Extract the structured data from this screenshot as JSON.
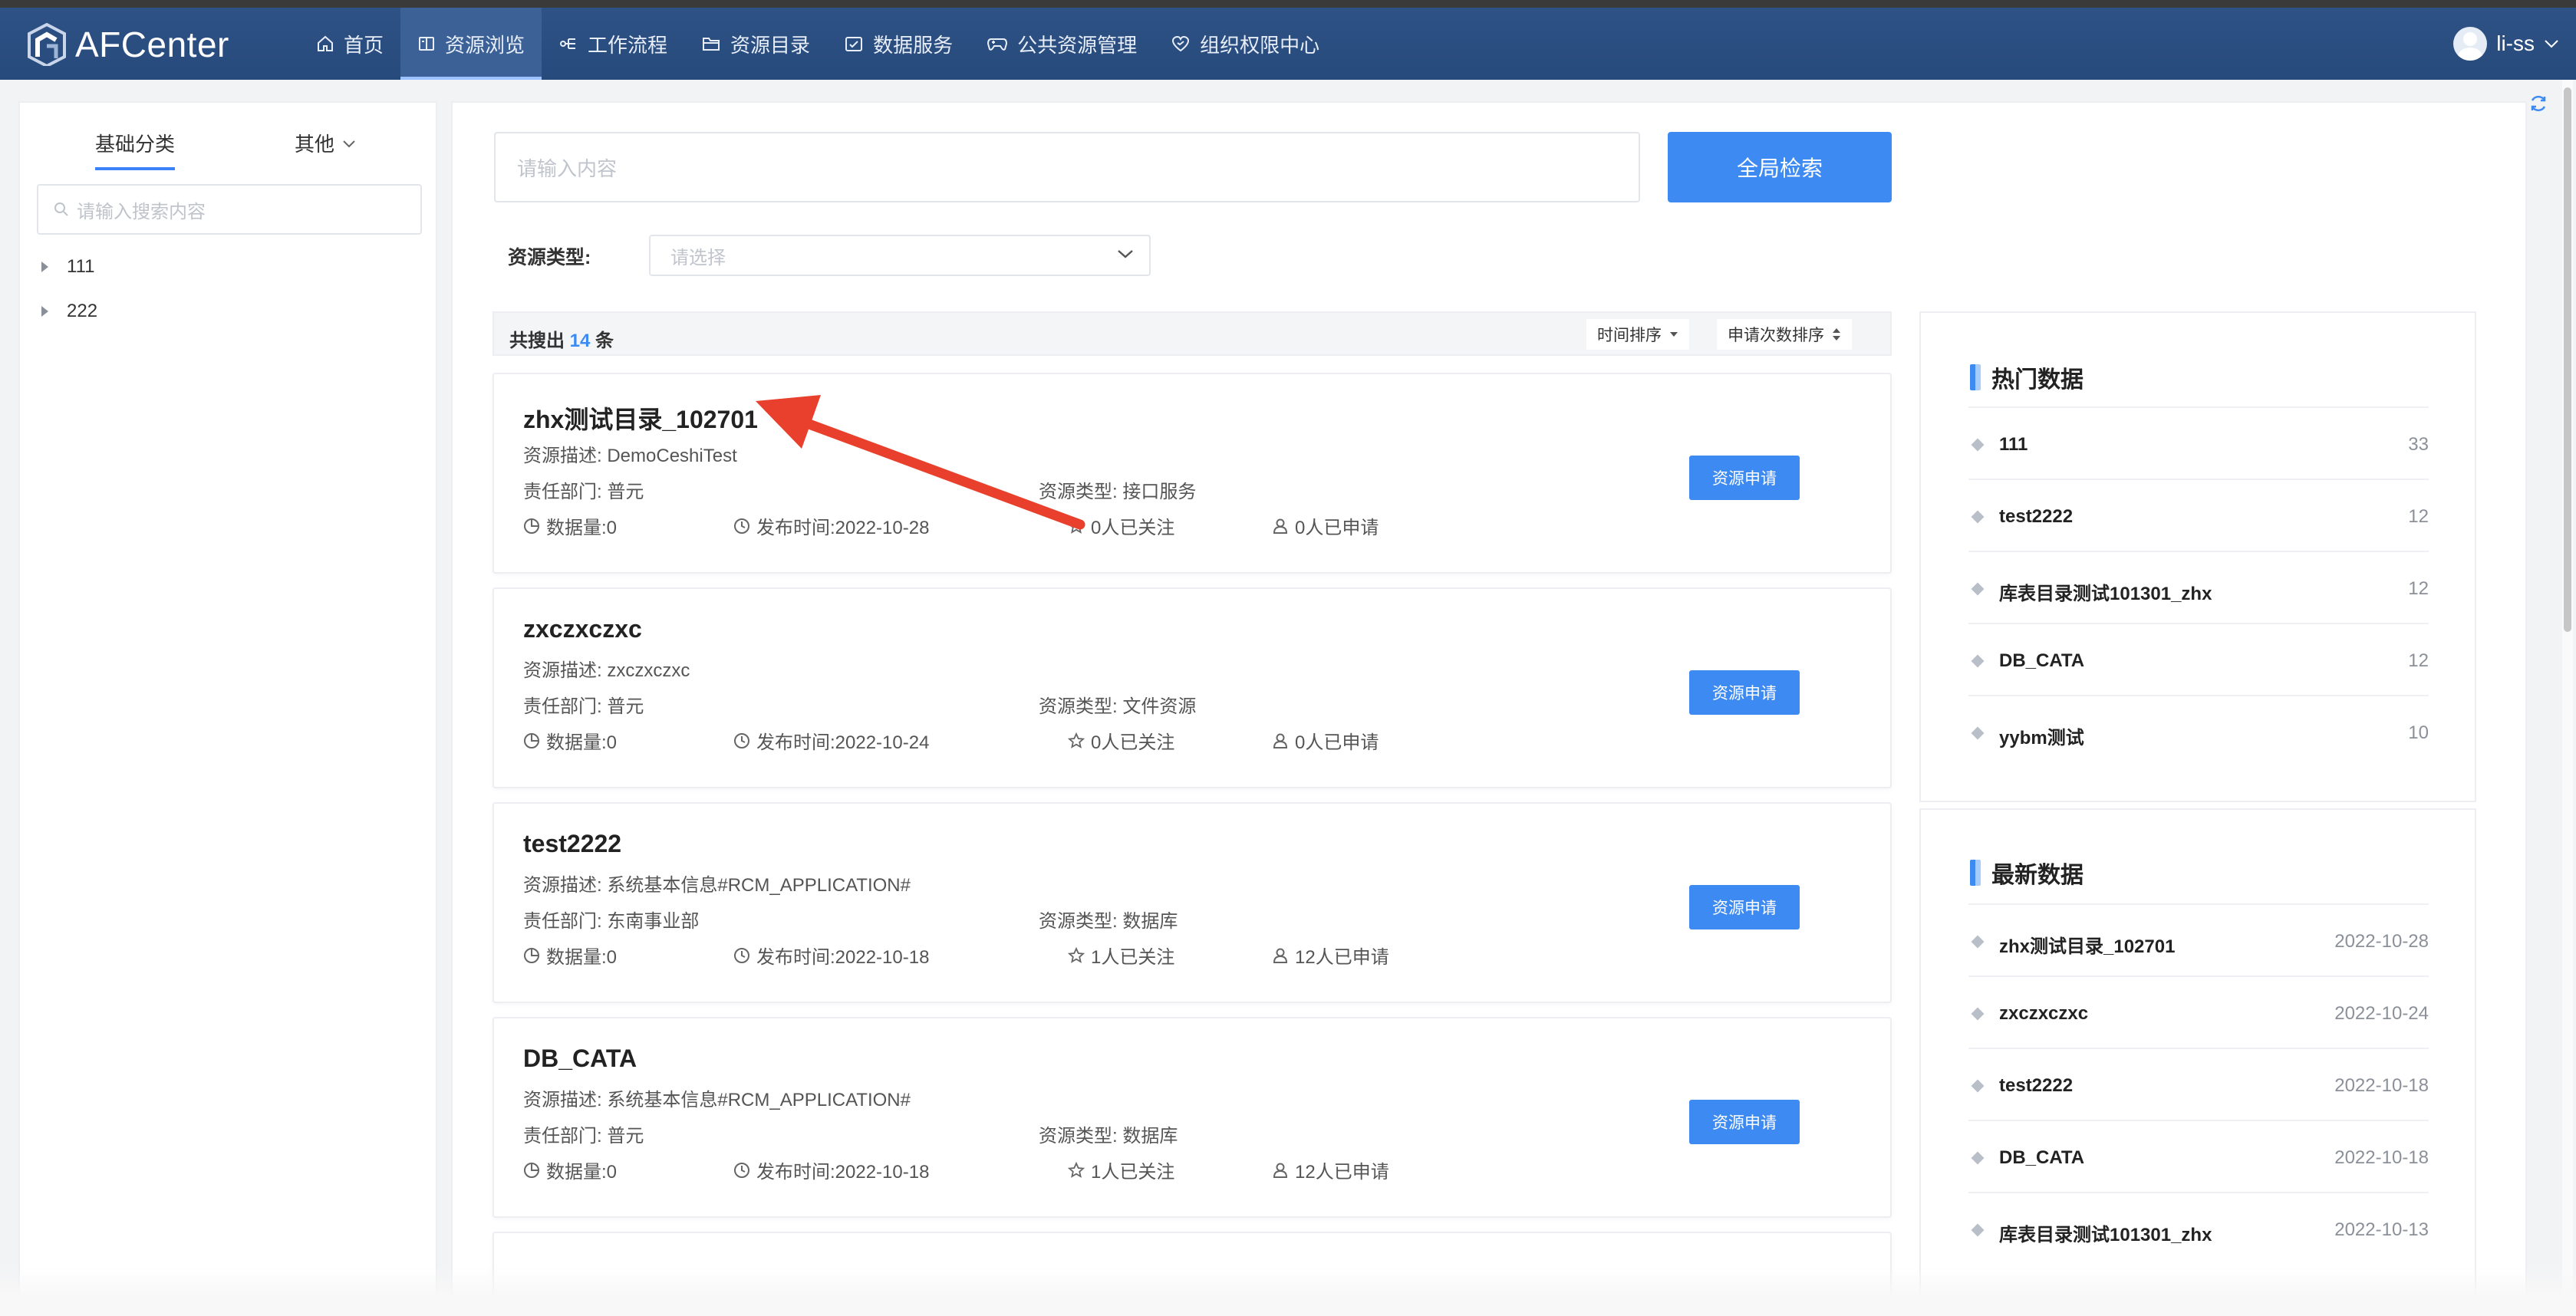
{
  "app": {
    "title": "AFCenter"
  },
  "nav": {
    "items": [
      {
        "label": "首页",
        "icon": "home-icon"
      },
      {
        "label": "资源浏览",
        "icon": "book-icon"
      },
      {
        "label": "工作流程",
        "icon": "flow-icon"
      },
      {
        "label": "资源目录",
        "icon": "folder-icon"
      },
      {
        "label": "数据服务",
        "icon": "calendar-check-icon"
      },
      {
        "label": "公共资源管理",
        "icon": "gamepad-icon"
      },
      {
        "label": "组织权限中心",
        "icon": "heart-shield-icon"
      }
    ],
    "active_index": 1,
    "user": "li-ss"
  },
  "sidebar": {
    "tabs": [
      "基础分类",
      "其他"
    ],
    "search_placeholder": "请输入搜索内容",
    "tree": [
      "111",
      "222"
    ]
  },
  "search": {
    "placeholder": "请输入内容",
    "button": "全局检索",
    "type_label": "资源类型:",
    "type_placeholder": "请选择"
  },
  "results": {
    "prefix": "共搜出",
    "count": "14",
    "suffix": "条",
    "sort_time": "时间排序",
    "sort_apply": "申请次数排序"
  },
  "cards": [
    {
      "title": "zhx测试目录_102701",
      "desc_label": "资源描述:",
      "desc": "DemoCeshiTest",
      "dept_label": "责任部门:",
      "dept": "普元",
      "type_label": "资源类型:",
      "type": "接口服务",
      "volume": "数据量:0",
      "publish": "发布时间:2022-10-28",
      "follow": "0人已关注",
      "applied": "0人已申请",
      "button": "资源申请"
    },
    {
      "title": "zxczxczxc",
      "desc_label": "资源描述:",
      "desc": "zxczxczxc",
      "dept_label": "责任部门:",
      "dept": "普元",
      "type_label": "资源类型:",
      "type": "文件资源",
      "volume": "数据量:0",
      "publish": "发布时间:2022-10-24",
      "follow": "0人已关注",
      "applied": "0人已申请",
      "button": "资源申请"
    },
    {
      "title": "test2222",
      "desc_label": "资源描述:",
      "desc": "系统基本信息#RCM_APPLICATION#",
      "dept_label": "责任部门:",
      "dept": "东南事业部",
      "type_label": "资源类型:",
      "type": "数据库",
      "volume": "数据量:0",
      "publish": "发布时间:2022-10-18",
      "follow": "1人已关注",
      "applied": "12人已申请",
      "button": "资源申请"
    },
    {
      "title": "DB_CATA",
      "desc_label": "资源描述:",
      "desc": "系统基本信息#RCM_APPLICATION#",
      "dept_label": "责任部门:",
      "dept": "普元",
      "type_label": "资源类型:",
      "type": "数据库",
      "volume": "数据量:0",
      "publish": "发布时间:2022-10-18",
      "follow": "1人已关注",
      "applied": "12人已申请",
      "button": "资源申请"
    }
  ],
  "hot": {
    "title": "热门数据",
    "items": [
      {
        "name": "111",
        "value": "33"
      },
      {
        "name": "test2222",
        "value": "12"
      },
      {
        "name": "库表目录测试101301_zhx",
        "value": "12"
      },
      {
        "name": "DB_CATA",
        "value": "12"
      },
      {
        "name": "yybm测试",
        "value": "10"
      }
    ]
  },
  "latest": {
    "title": "最新数据",
    "items": [
      {
        "name": "zhx测试目录_102701",
        "value": "2022-10-28"
      },
      {
        "name": "zxczxczxc",
        "value": "2022-10-24"
      },
      {
        "name": "test2222",
        "value": "2022-10-18"
      },
      {
        "name": "DB_CATA",
        "value": "2022-10-18"
      },
      {
        "name": "库表目录测试101301_zhx",
        "value": "2022-10-13"
      }
    ]
  },
  "colors": {
    "nav_bg": "#2f5286",
    "accent": "#3d8bf2",
    "annotation_arrow": "#e8402c"
  }
}
